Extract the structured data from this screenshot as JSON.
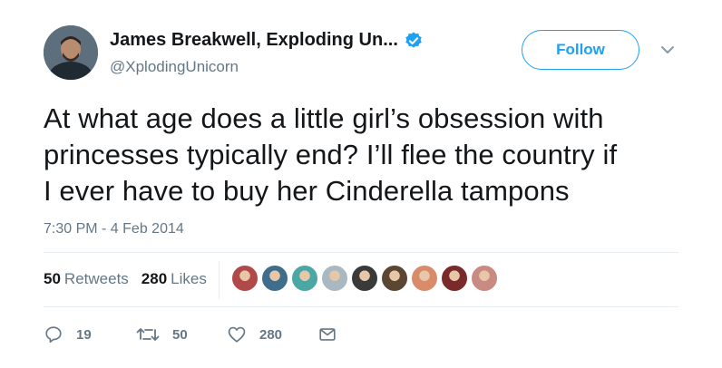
{
  "author": {
    "display_name": "James Breakwell, Exploding Un...",
    "handle": "@XplodingUnicorn",
    "verified": true
  },
  "follow_label": "Follow",
  "tweet": {
    "text_lines": [
      "At what age does a little girl’s obsession with",
      "princesses typically end? I’ll flee the country if",
      "I ever have to buy her Cinderella tampons"
    ],
    "timestamp": "7:30 PM - 4 Feb 2014"
  },
  "stats": {
    "retweets_count": "50",
    "retweets_label": "Retweets",
    "likes_count": "280",
    "likes_label": "Likes"
  },
  "liker_avatars": [
    {
      "name": "liker-avatar-1",
      "color": "#b04a4a"
    },
    {
      "name": "liker-avatar-2",
      "color": "#3f6e8c"
    },
    {
      "name": "liker-avatar-3",
      "color": "#4aa7a3"
    },
    {
      "name": "liker-avatar-4",
      "color": "#aab8c2"
    },
    {
      "name": "liker-avatar-5",
      "color": "#3a3a3a"
    },
    {
      "name": "liker-avatar-6",
      "color": "#5a4632"
    },
    {
      "name": "liker-avatar-7",
      "color": "#d98c6a"
    },
    {
      "name": "liker-avatar-8",
      "color": "#7a2a2a"
    },
    {
      "name": "liker-avatar-9",
      "color": "#c98a84"
    }
  ],
  "actions": {
    "reply_count": "19",
    "retweet_count": "50",
    "like_count": "280"
  },
  "colors": {
    "accent": "#1da1f2",
    "text": "#14171a",
    "secondary": "#657786",
    "divider": "#e6ecf0"
  }
}
